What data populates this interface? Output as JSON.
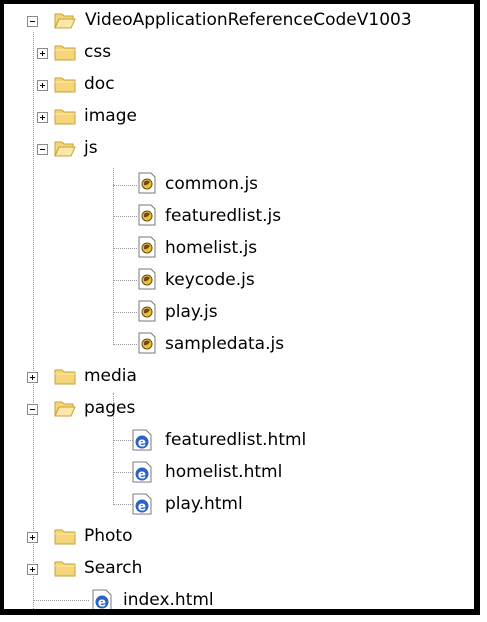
{
  "tree": {
    "root": {
      "label": "VideoApplicationReferenceCodeV1003",
      "expanded": true
    },
    "items": [
      {
        "label": "css",
        "type": "folder",
        "expanded": false
      },
      {
        "label": "doc",
        "type": "folder",
        "expanded": false
      },
      {
        "label": "image",
        "type": "folder",
        "expanded": false
      },
      {
        "label": "js",
        "type": "folder",
        "expanded": true
      },
      {
        "label": "common.js",
        "type": "js-file"
      },
      {
        "label": "featuredlist.js",
        "type": "js-file"
      },
      {
        "label": "homelist.js",
        "type": "js-file"
      },
      {
        "label": "keycode.js",
        "type": "js-file"
      },
      {
        "label": "play.js",
        "type": "js-file"
      },
      {
        "label": "sampledata.js",
        "type": "js-file"
      },
      {
        "label": "media",
        "type": "folder",
        "expanded": false
      },
      {
        "label": "pages",
        "type": "folder",
        "expanded": true
      },
      {
        "label": "featuredlist.html",
        "type": "html-file"
      },
      {
        "label": "homelist.html",
        "type": "html-file"
      },
      {
        "label": "play.html",
        "type": "html-file"
      },
      {
        "label": "Photo",
        "type": "folder",
        "expanded": false
      },
      {
        "label": "Search",
        "type": "folder",
        "expanded": false
      },
      {
        "label": "index.html",
        "type": "html-file"
      }
    ]
  },
  "colors": {
    "folder_fill": "#f5d77a",
    "folder_stroke": "#c9a23a",
    "ie_blue": "#2a64c8",
    "tree_line": "#9a9a9a"
  }
}
